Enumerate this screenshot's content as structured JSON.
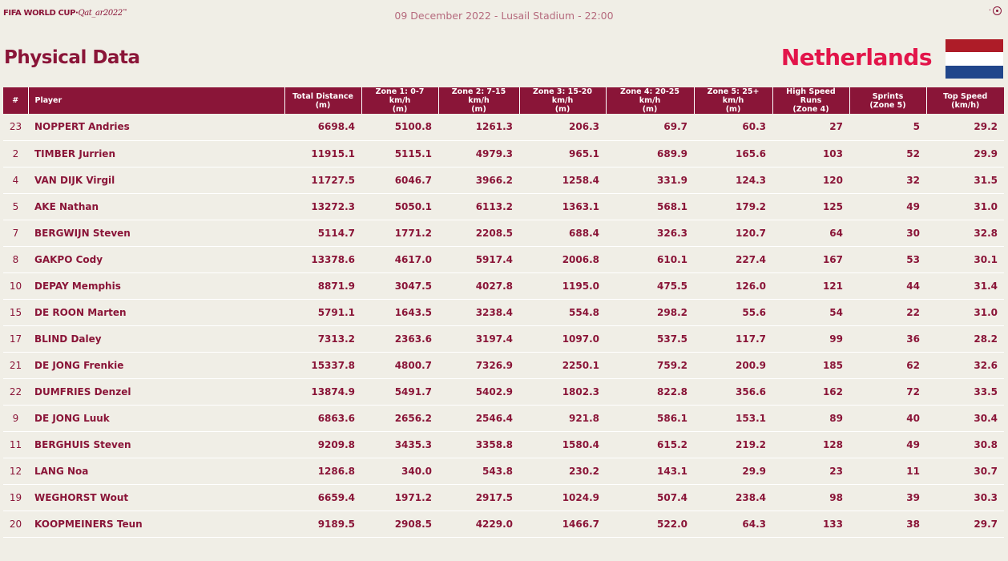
{
  "header": {
    "brand": "FIFA WORLD CUP",
    "brand_dot": "·",
    "brand_sub": "Qat_ar2022",
    "match_info": "09 December 2022 - Lusail Stadium - 22:00",
    "brand_mark_icon": "fifa-emblem-icon"
  },
  "page_title": "Physical Data",
  "team": {
    "name": "Netherlands",
    "flag_colors": [
      "#ae1c28",
      "#ffffff",
      "#21468b"
    ]
  },
  "colors": {
    "primary": "#8a1538",
    "accent": "#e2154a",
    "background": "#f0eee6"
  },
  "table": {
    "columns": [
      {
        "line1": "#",
        "line2": ""
      },
      {
        "line1": "Player",
        "line2": ""
      },
      {
        "line1": "Total Distance",
        "line2": "(m)"
      },
      {
        "line1": "Zone 1: 0-7 km/h",
        "line2": "(m)"
      },
      {
        "line1": "Zone 2: 7-15 km/h",
        "line2": "(m)"
      },
      {
        "line1": "Zone 3: 15-20 km/h",
        "line2": "(m)"
      },
      {
        "line1": "Zone 4: 20-25 km/h",
        "line2": "(m)"
      },
      {
        "line1": "Zone 5: 25+ km/h",
        "line2": "(m)"
      },
      {
        "line1": "High Speed Runs",
        "line2": "(Zone 4)"
      },
      {
        "line1": "Sprints",
        "line2": "(Zone 5)"
      },
      {
        "line1": "Top Speed",
        "line2": "(km/h)"
      }
    ],
    "rows": [
      [
        "23",
        "NOPPERT Andries",
        "6698.4",
        "5100.8",
        "1261.3",
        "206.3",
        "69.7",
        "60.3",
        "27",
        "5",
        "29.2"
      ],
      [
        "2",
        "TIMBER Jurrien",
        "11915.1",
        "5115.1",
        "4979.3",
        "965.1",
        "689.9",
        "165.6",
        "103",
        "52",
        "29.9"
      ],
      [
        "4",
        "VAN DIJK Virgil",
        "11727.5",
        "6046.7",
        "3966.2",
        "1258.4",
        "331.9",
        "124.3",
        "120",
        "32",
        "31.5"
      ],
      [
        "5",
        "AKE Nathan",
        "13272.3",
        "5050.1",
        "6113.2",
        "1363.1",
        "568.1",
        "179.2",
        "125",
        "49",
        "31.0"
      ],
      [
        "7",
        "BERGWIJN Steven",
        "5114.7",
        "1771.2",
        "2208.5",
        "688.4",
        "326.3",
        "120.7",
        "64",
        "30",
        "32.8"
      ],
      [
        "8",
        "GAKPO Cody",
        "13378.6",
        "4617.0",
        "5917.4",
        "2006.8",
        "610.1",
        "227.4",
        "167",
        "53",
        "30.1"
      ],
      [
        "10",
        "DEPAY Memphis",
        "8871.9",
        "3047.5",
        "4027.8",
        "1195.0",
        "475.5",
        "126.0",
        "121",
        "44",
        "31.4"
      ],
      [
        "15",
        "DE ROON Marten",
        "5791.1",
        "1643.5",
        "3238.4",
        "554.8",
        "298.2",
        "55.6",
        "54",
        "22",
        "31.0"
      ],
      [
        "17",
        "BLIND Daley",
        "7313.2",
        "2363.6",
        "3197.4",
        "1097.0",
        "537.5",
        "117.7",
        "99",
        "36",
        "28.2"
      ],
      [
        "21",
        "DE JONG Frenkie",
        "15337.8",
        "4800.7",
        "7326.9",
        "2250.1",
        "759.2",
        "200.9",
        "185",
        "62",
        "32.6"
      ],
      [
        "22",
        "DUMFRIES Denzel",
        "13874.9",
        "5491.7",
        "5402.9",
        "1802.3",
        "822.8",
        "356.6",
        "162",
        "72",
        "33.5"
      ],
      [
        "9",
        "DE JONG Luuk",
        "6863.6",
        "2656.2",
        "2546.4",
        "921.8",
        "586.1",
        "153.1",
        "89",
        "40",
        "30.4"
      ],
      [
        "11",
        "BERGHUIS Steven",
        "9209.8",
        "3435.3",
        "3358.8",
        "1580.4",
        "615.2",
        "219.2",
        "128",
        "49",
        "30.8"
      ],
      [
        "12",
        "LANG Noa",
        "1286.8",
        "340.0",
        "543.8",
        "230.2",
        "143.1",
        "29.9",
        "23",
        "11",
        "30.7"
      ],
      [
        "19",
        "WEGHORST Wout",
        "6659.4",
        "1971.2",
        "2917.5",
        "1024.9",
        "507.4",
        "238.4",
        "98",
        "39",
        "30.3"
      ],
      [
        "20",
        "KOOPMEINERS Teun",
        "9189.5",
        "2908.5",
        "4229.0",
        "1466.7",
        "522.0",
        "64.3",
        "133",
        "38",
        "29.7"
      ]
    ]
  }
}
